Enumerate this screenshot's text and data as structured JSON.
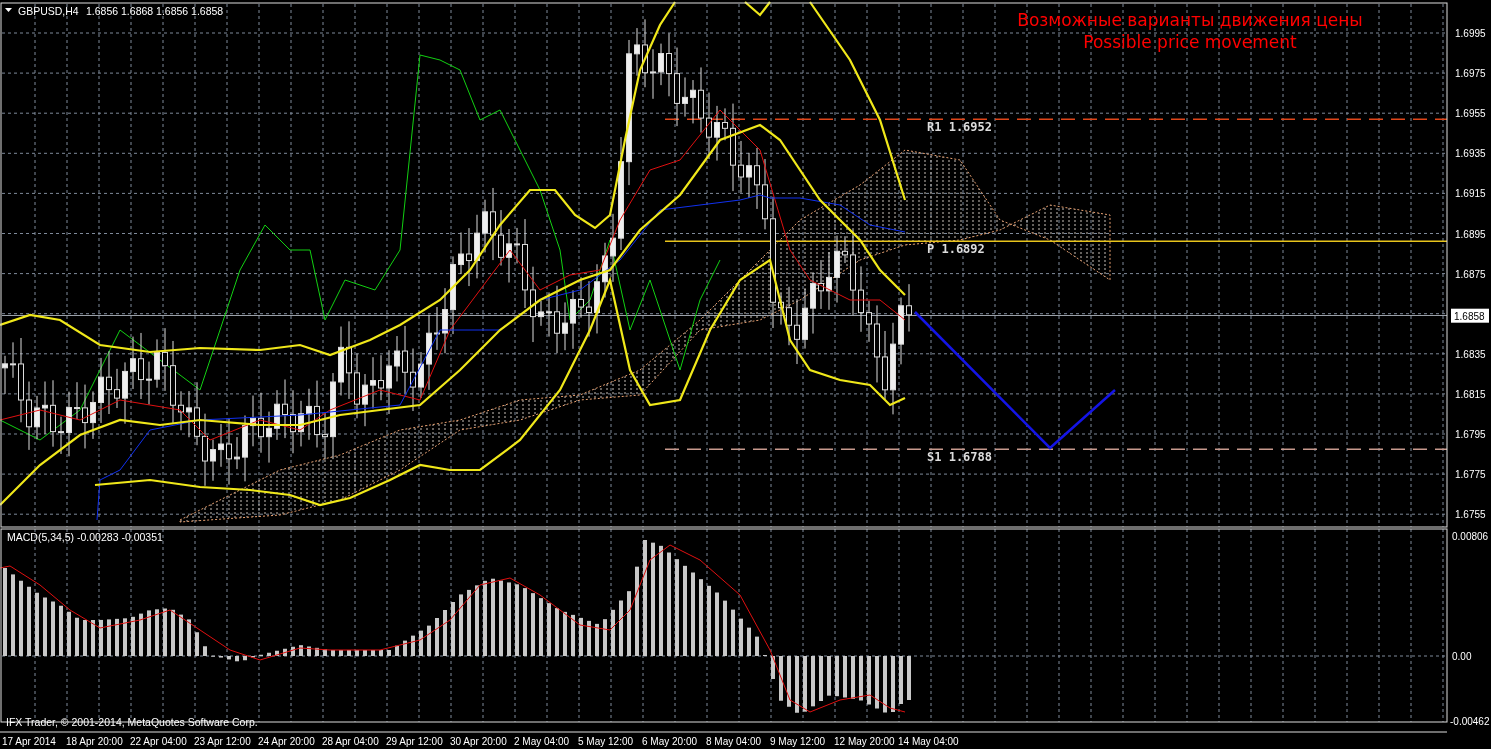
{
  "chart": {
    "symbol": "GBPUSD,H4",
    "ohlc": "1.6856 1.6868 1.6856 1.6858",
    "annotation": [
      "Возможные варианты движения цены",
      "Possible price movement"
    ],
    "levels": [
      {
        "label": "R1 1.6952",
        "kind": "dashed",
        "color": "#e0461a"
      },
      {
        "label": "P 1.6892",
        "kind": "solid",
        "color": "#e8c41c"
      },
      {
        "label": "S1 1.6788",
        "kind": "dashed",
        "color": "#c89a8e"
      }
    ],
    "price_axis": [
      "1.6995",
      "1.6975",
      "1.6955",
      "1.6935",
      "1.6915",
      "1.6895",
      "1.6875",
      "1.6835",
      "1.6815",
      "1.6795",
      "1.6775",
      "1.6755"
    ],
    "current_price": "1.6858"
  },
  "macd": {
    "label": "MACD(5,34,5) -0.00283 -0.00351",
    "axis": [
      "0.00806",
      "0.00",
      "-0.00462"
    ]
  },
  "time_axis": [
    "17 Apr 2014",
    "18 Apr 20:00",
    "22 Apr 04:00",
    "23 Apr 12:00",
    "24 Apr 20:00",
    "28 Apr 04:00",
    "29 Apr 12:00",
    "30 Apr 20:00",
    "2 May 04:00",
    "5 May 12:00",
    "6 May 20:00",
    "8 May 04:00",
    "9 May 12:00",
    "12 May 20:00",
    "14 May 04:00"
  ],
  "copyright": "IFX Trader, © 2001-2014, MetaQuotes Software Corp."
}
